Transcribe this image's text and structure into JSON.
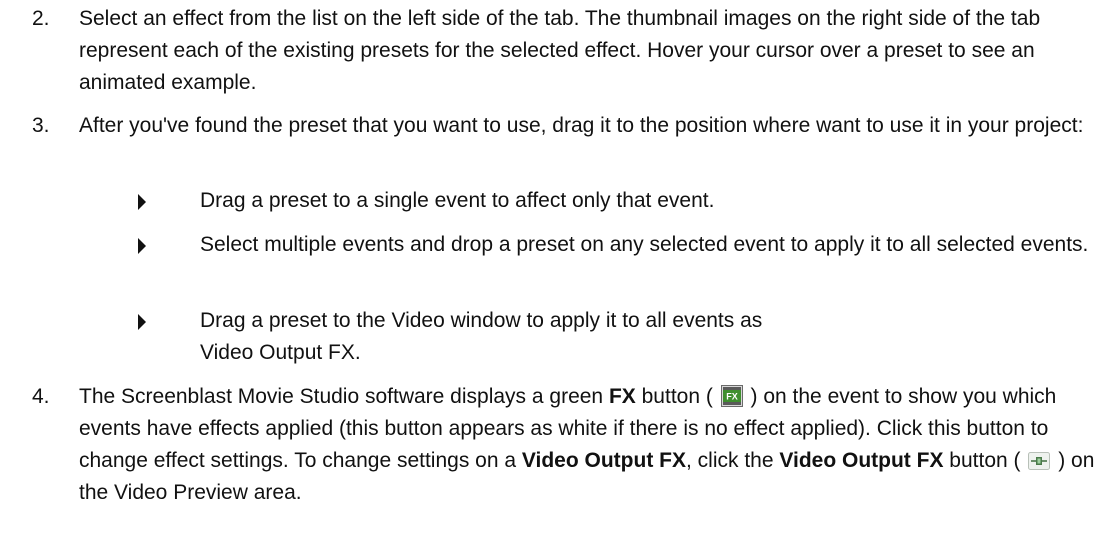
{
  "steps": [
    {
      "number": "2.",
      "text": "Select an effect from the list on the left side of the tab. The thumbnail images on the right side of the tab represent each of the existing presets for the selected effect. Hover your cursor over a preset to see an animated example."
    },
    {
      "number": "3.",
      "text": "After you've found the preset that you want to use, drag it to the position where want to use it in your project:",
      "bullets": [
        "Drag a preset to a single event to affect only that event.",
        "Select multiple events and drop a preset on any selected event to apply it to all selected events.",
        "Drag a preset to the Video window to apply it to all events as Video Output FX."
      ]
    },
    {
      "number": "4.",
      "part1": "The Screenblast Movie Studio software displays a green ",
      "bold1": "FX",
      "part2": " button ( ",
      "part3": " ) on the event to show you which events have effects applied (this button appears as white if there is no effect applied). Click this button to change effect settings. To change settings on a ",
      "bold2": "Video Output FX",
      "part4": ", click the ",
      "bold3": "Video Output FX",
      "part5": " button ( ",
      "part6": " ) on the Video Preview area."
    }
  ],
  "icons": {
    "fx_button": "fx-button-icon",
    "video_output_fx_button": "video-output-fx-icon",
    "bullet": "triangle-bullet-icon"
  },
  "colors": {
    "fx_green": "#3f8f2f"
  }
}
